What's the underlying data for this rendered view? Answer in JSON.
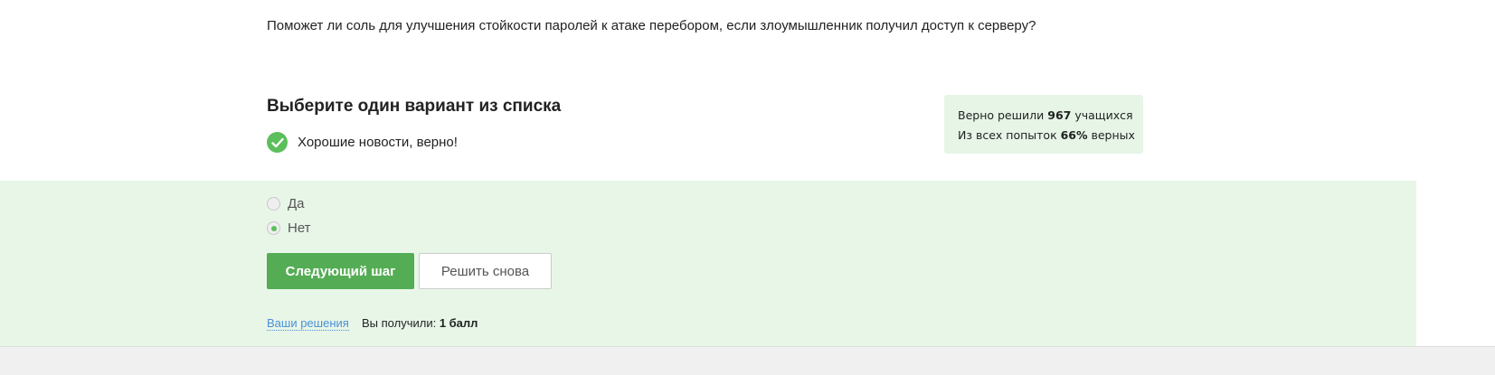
{
  "question": {
    "text": "Поможет ли соль для улучшения стойкости паролей к атаке перебором, если злоумышленник получил доступ к серверу?"
  },
  "quiz": {
    "title": "Выберите один вариант из списка",
    "feedback": "Хорошие новости, верно!",
    "options": [
      {
        "label": "Да",
        "selected": false
      },
      {
        "label": "Нет",
        "selected": true
      }
    ]
  },
  "stats": {
    "solved_prefix": "Верно решили ",
    "solved_count": "967",
    "solved_suffix": " учащихся",
    "attempts_prefix": "Из всех попыток ",
    "attempts_percent": "66%",
    "attempts_suffix": " верных"
  },
  "actions": {
    "next_label": "Следующий шаг",
    "retry_label": "Решить снова"
  },
  "footer": {
    "solutions_link": "Ваши решения",
    "score_prefix": "Вы получили: ",
    "score_value": "1 балл"
  },
  "colors": {
    "accent_green": "#54ad54",
    "success_bg": "#e8f6e8",
    "link_blue": "#4a90d9"
  },
  "icons": {
    "feedback": "check-circle-icon"
  }
}
